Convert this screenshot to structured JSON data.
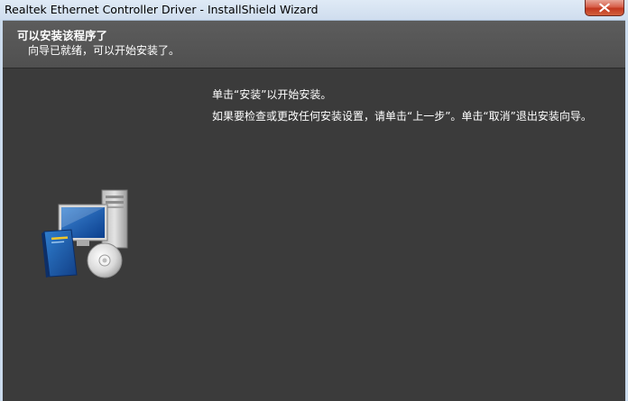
{
  "window": {
    "title": "Realtek Ethernet Controller Driver - InstallShield Wizard"
  },
  "header": {
    "title": "可以安装该程序了",
    "subtitle": "向导已就绪，可以开始安装了。"
  },
  "body": {
    "line1": "单击“安装”以开始安装。",
    "line2": "如果要检查或更改任何安装设置，请单击“上一步”。单击“取消”退出安装向导。"
  },
  "icons": {
    "close": "close-icon",
    "illustration": "computer-install-icon"
  },
  "colors": {
    "background": "#3b3b3b",
    "header": "#565656",
    "close_button": "#c9452c"
  }
}
